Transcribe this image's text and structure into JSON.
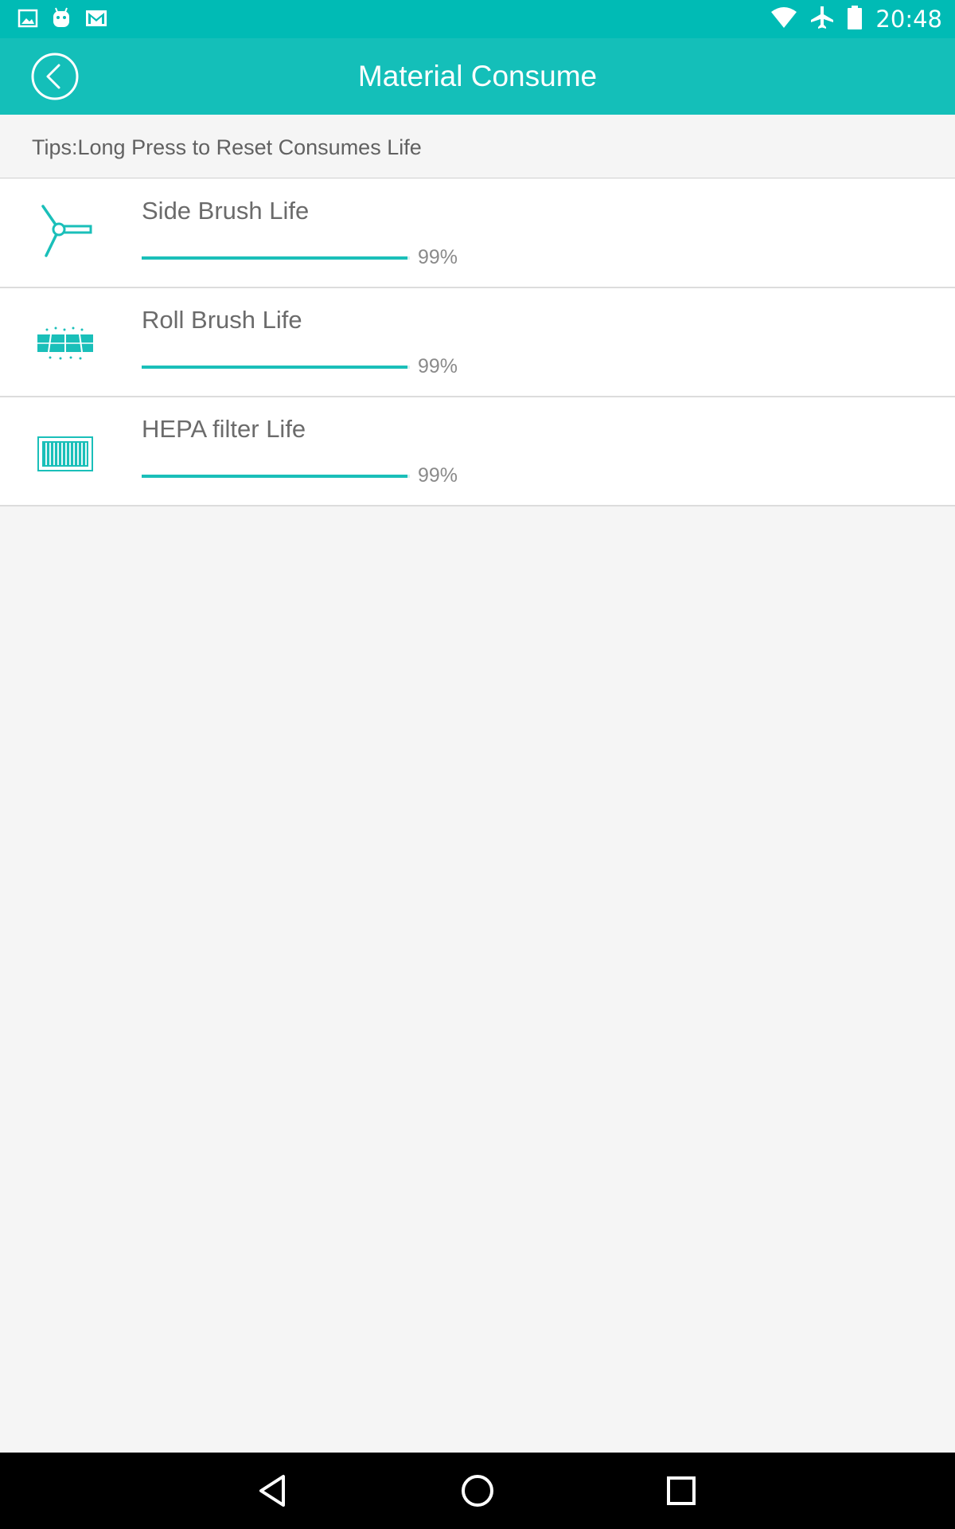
{
  "status_bar": {
    "time": "20:48",
    "left_icons": [
      "image-icon",
      "android-icon",
      "gmail-icon"
    ],
    "right_icons": [
      "wifi-icon",
      "airplane-mode-icon",
      "battery-icon"
    ]
  },
  "header": {
    "title": "Material Consume",
    "back_icon": "back-arrow-circle-icon"
  },
  "tips": {
    "text": "Tips:Long Press to Reset Consumes Life"
  },
  "items": [
    {
      "label": "Side Brush Life",
      "percent_label": "99%",
      "percent": 99,
      "icon": "side-brush-icon"
    },
    {
      "label": "Roll Brush Life",
      "percent_label": "99%",
      "percent": 99,
      "icon": "roll-brush-icon"
    },
    {
      "label": "HEPA filter Life",
      "percent_label": "99%",
      "percent": 99,
      "icon": "hepa-filter-icon"
    }
  ],
  "nav_bar": {
    "icons": [
      "back-triangle-icon",
      "home-circle-icon",
      "recents-square-icon"
    ]
  },
  "colors": {
    "status_bar": "#00bbb5",
    "app_bar": "#14bfb9",
    "accent": "#1abfb9",
    "background": "#f5f5f5"
  }
}
